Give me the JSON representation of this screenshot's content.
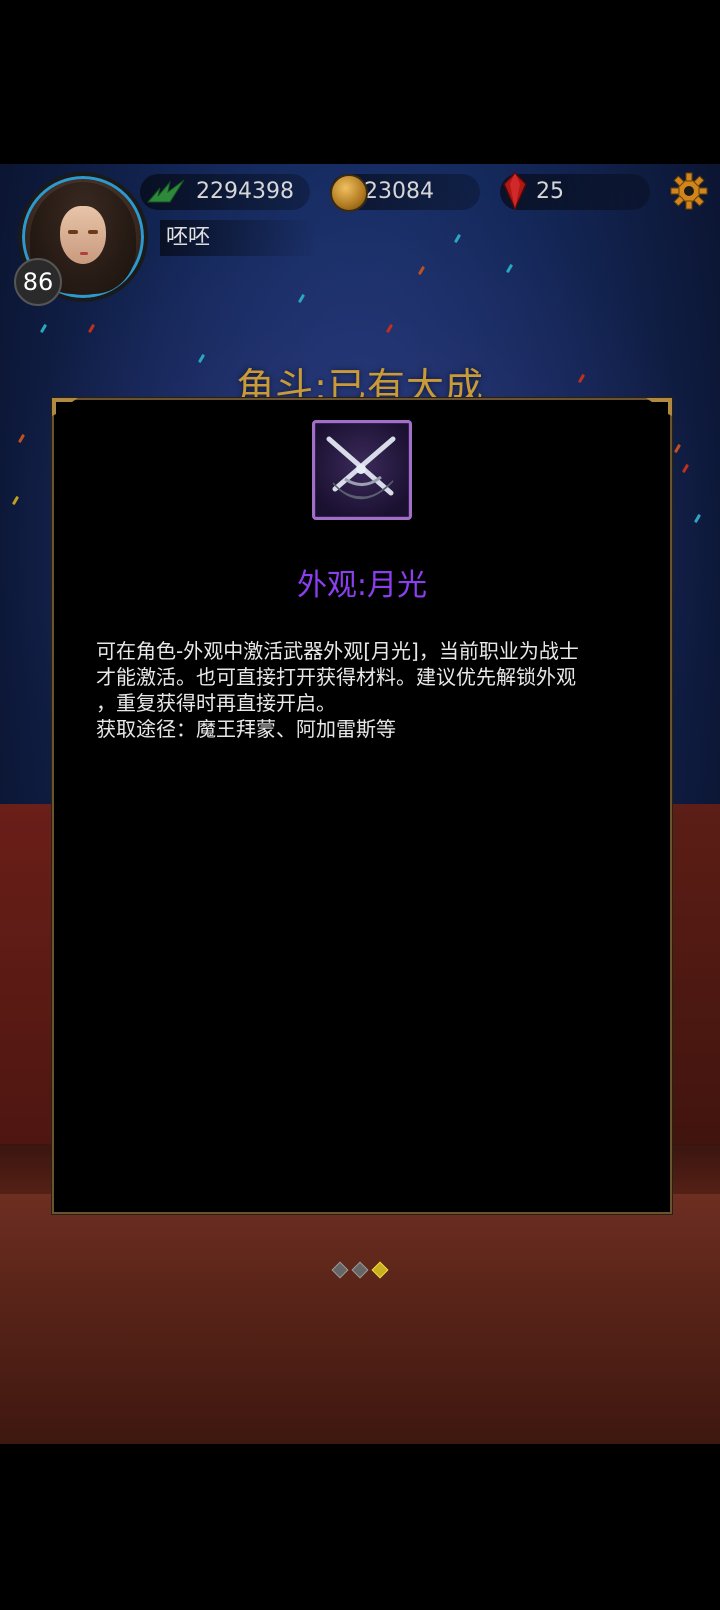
{
  "player": {
    "level": "86",
    "name": "呸呸",
    "experience": "2294398",
    "gold": "23084",
    "gems": "25"
  },
  "icons": {
    "experience": "wing-icon",
    "gold": "coin-icon",
    "gems": "red-gem-icon",
    "settings": "gear-icon",
    "item": "crossed-swords-moonlight-icon"
  },
  "arena": {
    "title": "角斗:已有大成"
  },
  "item_popup": {
    "title": "外观:月光",
    "description_lines": [
      "可在角色-外观中激活武器外观[月光]，当前职业为战士",
      "才能激活。也可直接打开获得材料。建议优先解锁外观",
      "，重复获得时再直接开启。",
      "获取途径：魔王拜蒙、阿加雷斯等"
    ]
  },
  "pager": {
    "total": 3,
    "active": 3
  },
  "colors": {
    "title_purple": "#8b3ff0",
    "arena_gold": "#c99a38",
    "modal_border": "#6a5330",
    "active_dot": "#c8b020"
  }
}
